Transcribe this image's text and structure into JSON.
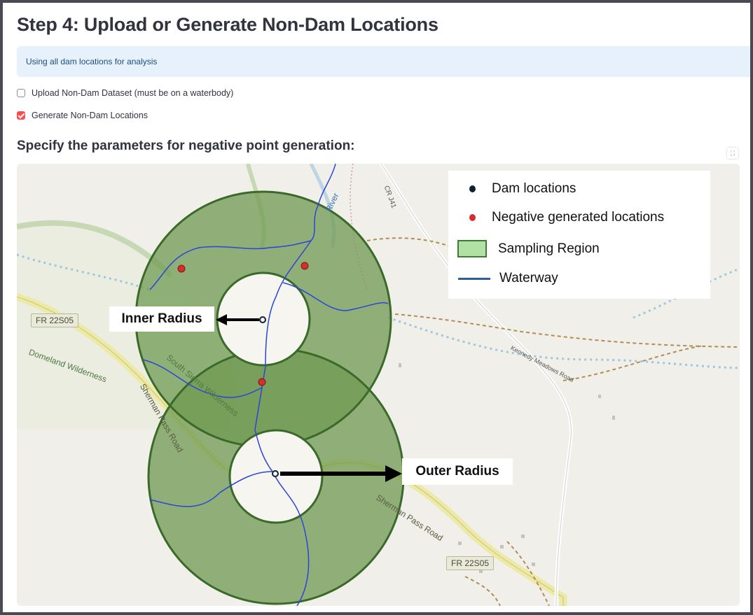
{
  "header": {
    "title": "Step 4: Upload or Generate Non-Dam Locations"
  },
  "info": {
    "message": "Using all dam locations for analysis"
  },
  "options": [
    {
      "label": "Upload Non-Dam Dataset (must be on a waterbody)",
      "checked": false
    },
    {
      "label": "Generate Non-Dam Locations",
      "checked": true
    }
  ],
  "params": {
    "heading": "Specify the parameters for negative point generation:"
  },
  "map": {
    "legend": {
      "dam": "Dam locations",
      "negative": "Negative generated locations",
      "region": "Sampling Region",
      "waterway": "Waterway"
    },
    "callouts": {
      "inner": "Inner Radius",
      "outer": "Outer Radius"
    },
    "labels": {
      "fr_badge_left": "FR 22S05",
      "fr_badge_right": "FR 22S05",
      "domeland": "Domeland Wilderness",
      "south_sierra": "South Sierra Wilderness",
      "sherman_left": "Sherman Pass Road",
      "sherman_right": "Sherman Pass Road",
      "kennedy": "Kennedy Meadows Road",
      "cr": "CR J41",
      "river": "River"
    },
    "colors": {
      "region_fill": "#6f9a52",
      "region_stroke": "#3a6a2a",
      "dam": "#0f2030",
      "negative": "#d32f2f",
      "waterway": "#2c45d6"
    }
  }
}
